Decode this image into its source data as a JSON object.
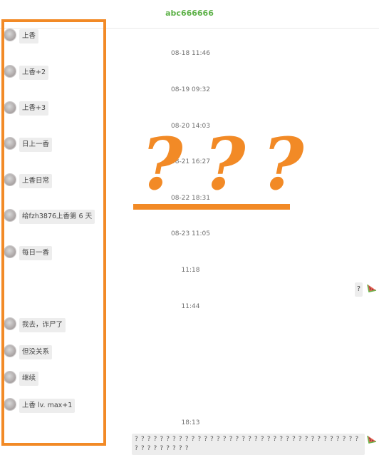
{
  "header": {
    "title": "abc666666"
  },
  "timestamps": [
    "08-18 11:46",
    "08-19 09:32",
    "08-20 14:03",
    "08-21 16:27",
    "08-22 18:31",
    "08-23 11:05",
    "11:18",
    "11:44",
    "18:13"
  ],
  "left_messages": [
    "上香",
    "上香+2",
    "上香+3",
    "日上一香",
    "上香日常",
    "给fzh3876上香第 6 天",
    "每日一香",
    "我去，诈尸了",
    "但没关系",
    "继续",
    "上香 lv. max+1"
  ],
  "right_messages": [
    {
      "text": "?"
    },
    {
      "text": "? ? ? ? ? ? ? ? ? ? ? ? ? ? ? ? ? ? ? ? ? ? ? ? ? ? ? ? ? ? ? ? ? ? ? ? ? ? ? ? ? ? ? ? ?"
    }
  ],
  "annotation": {
    "marks": [
      "?",
      "?",
      "?"
    ],
    "color": "#f28a26"
  },
  "colors": {
    "accent": "#5fb24a",
    "bubble": "#ededed",
    "annotation": "#f28a26"
  },
  "icons": {
    "left_avatar": "avatar-icon",
    "right_avatar": "watermelon-avatar-icon"
  }
}
